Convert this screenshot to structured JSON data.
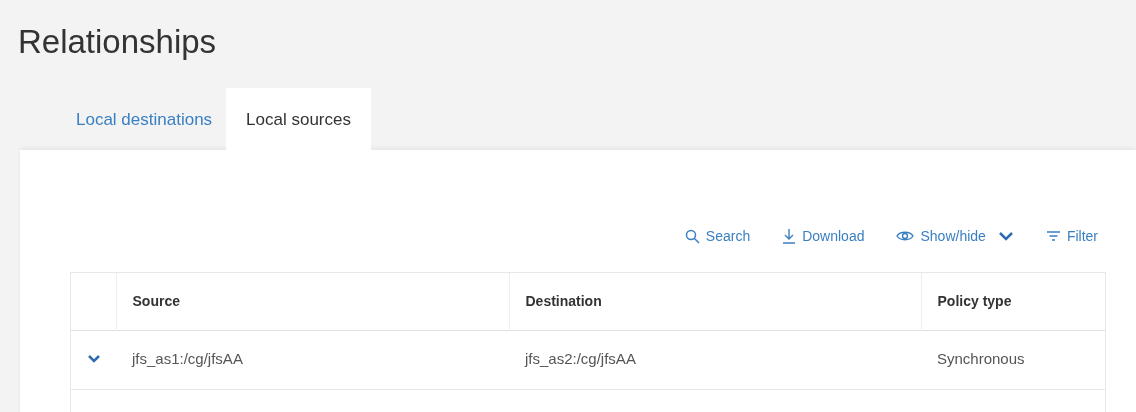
{
  "title": "Relationships",
  "tabs": [
    {
      "label": "Local destinations",
      "selected": false
    },
    {
      "label": "Local sources",
      "selected": true
    }
  ],
  "toolbar": [
    {
      "kind": "search",
      "label": "Search"
    },
    {
      "kind": "download",
      "label": "Download"
    },
    {
      "kind": "showhide",
      "label": "Show/hide"
    },
    {
      "kind": "filter",
      "label": "Filter"
    }
  ],
  "table": {
    "columns": [
      "Source",
      "Destination",
      "Policy type"
    ],
    "rows": [
      {
        "expanded": false,
        "cells": [
          "jfs_as1:/cg/jfsAA",
          "jfs_as2:/cg/jfsAA",
          "Synchronous"
        ]
      }
    ]
  }
}
